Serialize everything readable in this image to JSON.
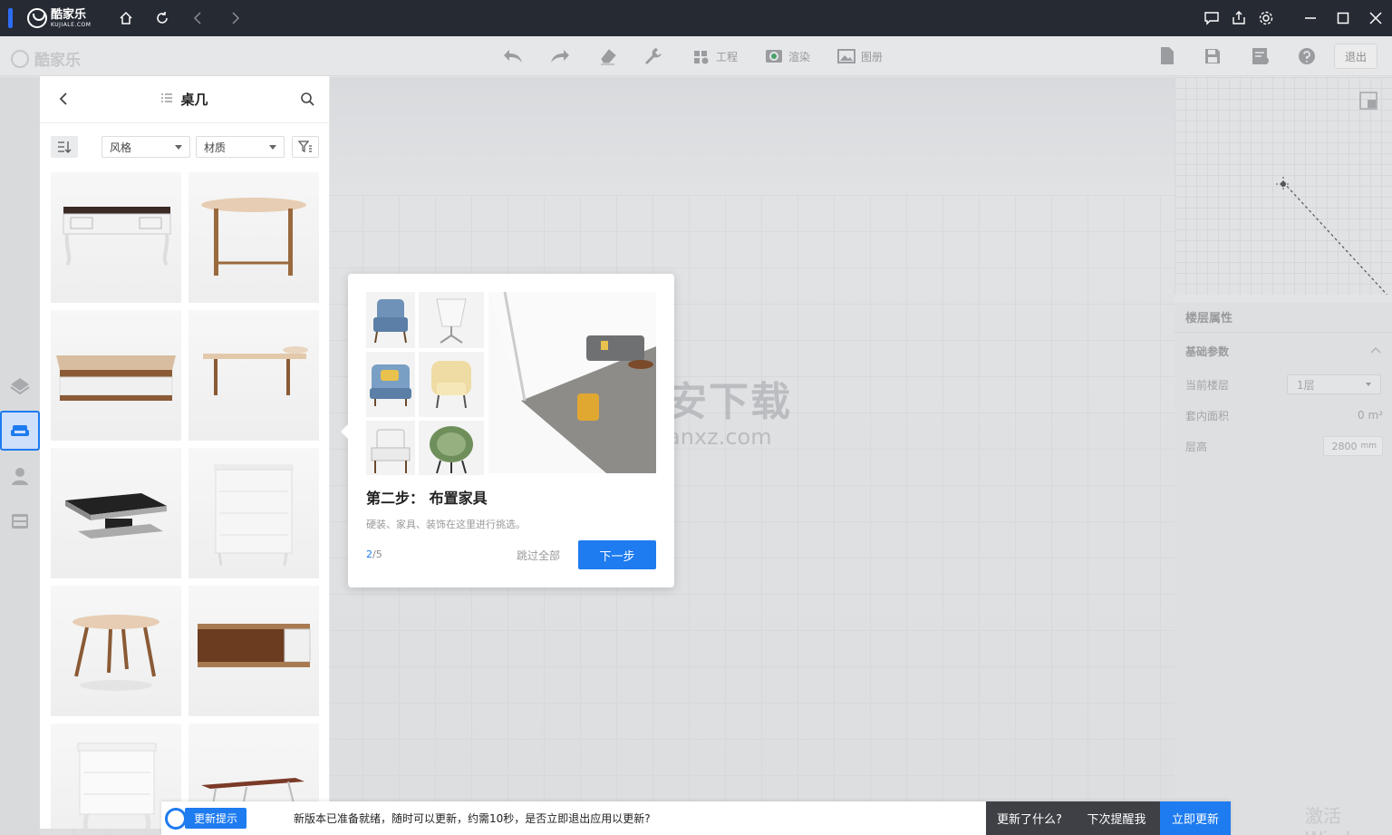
{
  "titlebar": {
    "brand_cn": "酷家乐",
    "brand_en": "KUJIALE.COM",
    "nav_icons": [
      "home-icon",
      "refresh-icon",
      "back-arrow-icon",
      "forward-arrow-icon"
    ],
    "right_icons": [
      "chat-icon",
      "share-icon",
      "settings-icon"
    ]
  },
  "toolbar": {
    "logo_text": "酷家乐",
    "project_label": "工程",
    "render_label": "渲染",
    "album_label": "图册",
    "exit_label": "退出"
  },
  "panel": {
    "title": "桌几",
    "style_dropdown": "风格",
    "material_dropdown": "材质",
    "product_icons": [
      "desk",
      "table",
      "coffee-table",
      "side-table",
      "black-coffee-table",
      "white-cabinet",
      "round-table",
      "tv-cabinet",
      "white-nightstand",
      "bench"
    ]
  },
  "guide": {
    "title": "第二步： 布置家具",
    "description": "硬装、家具、装饰在这里进行挑选。",
    "step_current": "2",
    "step_total": "/5",
    "skip_label": "跳过全部",
    "next_label": "下一步"
  },
  "watermark": {
    "shield_text": "安",
    "cn": "安下载",
    "en": "anxz.com"
  },
  "properties": {
    "title": "楼层属性",
    "section": "基础参数",
    "current_floor_label": "当前楼层",
    "current_floor_value": "1层",
    "area_label": "套内面积",
    "area_value": "0",
    "area_unit": "m²",
    "height_label": "层高",
    "height_value": "2800",
    "height_unit": "mm"
  },
  "activate_text": "激活 Wind",
  "update_bar": {
    "badge_label": "更新提示",
    "message": "新版本已准备就绪，随时可以更新，约需10秒，是否立即退出应用以更新?",
    "whats_new": "更新了什么?",
    "remind_later": "下次提醒我",
    "update_now": "立即更新"
  },
  "colors": {
    "accent": "#1e7bf0",
    "titlebar_bg": "#262a33",
    "dark_button": "#3e4046"
  }
}
